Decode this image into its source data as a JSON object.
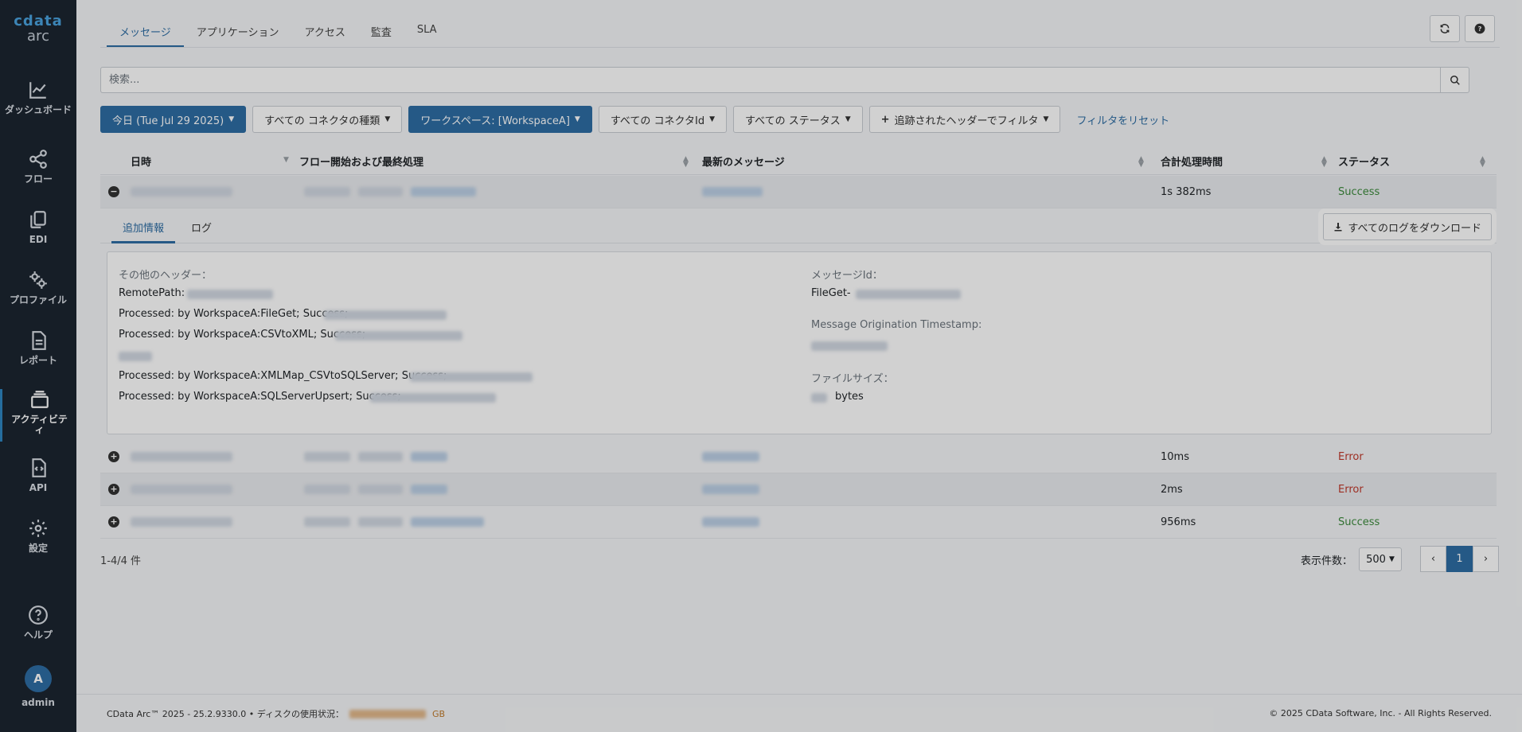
{
  "sidebar": {
    "logo_brand": "cdata",
    "logo_product": "arc",
    "items": [
      {
        "label": "ダッシュボード",
        "icon": "chart-line-icon"
      },
      {
        "label": "フロー",
        "icon": "share-nodes-icon"
      },
      {
        "label": "EDI",
        "icon": "copy-icon"
      },
      {
        "label": "プロファイル",
        "icon": "gears-icon"
      },
      {
        "label": "レポート",
        "icon": "document-icon"
      },
      {
        "label": "アクティビティ",
        "icon": "layers-icon",
        "active": true
      },
      {
        "label": "API",
        "icon": "code-file-icon"
      },
      {
        "label": "設定",
        "icon": "gear-icon"
      },
      {
        "label": "ヘルプ",
        "icon": "question-circle-icon"
      }
    ],
    "user_initial": "A",
    "user_name": "admin"
  },
  "tabs": [
    {
      "label": "メッセージ",
      "active": true
    },
    {
      "label": "アプリケーション"
    },
    {
      "label": "アクセス"
    },
    {
      "label": "監査"
    },
    {
      "label": "SLA"
    }
  ],
  "search": {
    "placeholder": "検索..."
  },
  "filters": {
    "date": "今日 (Tue Jul 29 2025)",
    "connector_type": "すべての コネクタの種類",
    "workspace": "ワークスペース: [WorkspaceA]",
    "connector_id": "すべての コネクタId",
    "status": "すべての ステータス",
    "header_filter": "追跡されたヘッダーでフィルタ",
    "reset": "フィルタをリセット"
  },
  "table": {
    "columns": [
      "日時",
      "フロー開始および最終処理",
      "最新のメッセージ",
      "合計処理時間",
      "ステータス"
    ],
    "rows": [
      {
        "duration": "1s 382ms",
        "status": "Success",
        "expanded": true
      },
      {
        "duration": "10ms",
        "status": "Error"
      },
      {
        "duration": "2ms",
        "status": "Error"
      },
      {
        "duration": "956ms",
        "status": "Success"
      }
    ]
  },
  "details": {
    "tab_info": "追加情報",
    "tab_log": "ログ",
    "download_label": "すべてのログをダウンロード",
    "other_headers_label": "その他のヘッダー：",
    "remote_path_label": "RemotePath:",
    "processed_1": "Processed: by WorkspaceA:FileGet; Success;",
    "processed_2": "Processed: by WorkspaceA:CSVtoXML; Success;",
    "processed_3": "Processed: by WorkspaceA:XMLMap_CSVtoSQLServer; Success;",
    "processed_4": "Processed: by WorkspaceA:SQLServerUpsert; Success;",
    "message_id_label": "メッセージId：",
    "message_id_prefix": "FileGet-",
    "origination_label": "Message Origination Timestamp:",
    "file_size_label": "ファイルサイズ：",
    "bytes_label": "bytes"
  },
  "pagination": {
    "info": "1-4/4 件",
    "page_size_label": "表示件数：",
    "page_size": "500",
    "current_page": "1",
    "prev": "‹",
    "next": "›"
  },
  "footer": {
    "version": "CData Arc™ 2025 - 25.2.9330.0",
    "disk_label": "ディスクの使用状況：",
    "disk_unit": "GB",
    "copyright": "© 2025 CData Software, Inc. - All Rights Reserved."
  }
}
